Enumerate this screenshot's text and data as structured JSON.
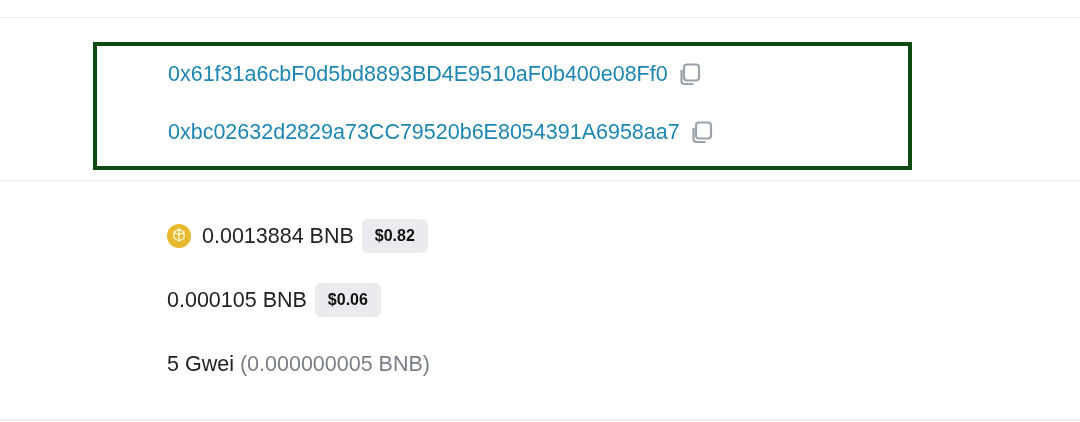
{
  "addresses": [
    {
      "value": "0x61f31a6cbF0d5bd8893BD4E9510aF0b400e08Ff0",
      "copyable": true
    },
    {
      "value": "0xbc02632d2829a73CC79520b6E8054391A6958aa7",
      "copyable": true
    }
  ],
  "amounts": [
    {
      "kind": "token",
      "amount": "0.0013884 BNB",
      "usd": "$0.82"
    },
    {
      "kind": "plain",
      "amount": "0.000105 BNB",
      "usd": "$0.06"
    },
    {
      "kind": "gas",
      "amount": "5 Gwei",
      "detail": "(0.000000005 BNB)"
    }
  ]
}
